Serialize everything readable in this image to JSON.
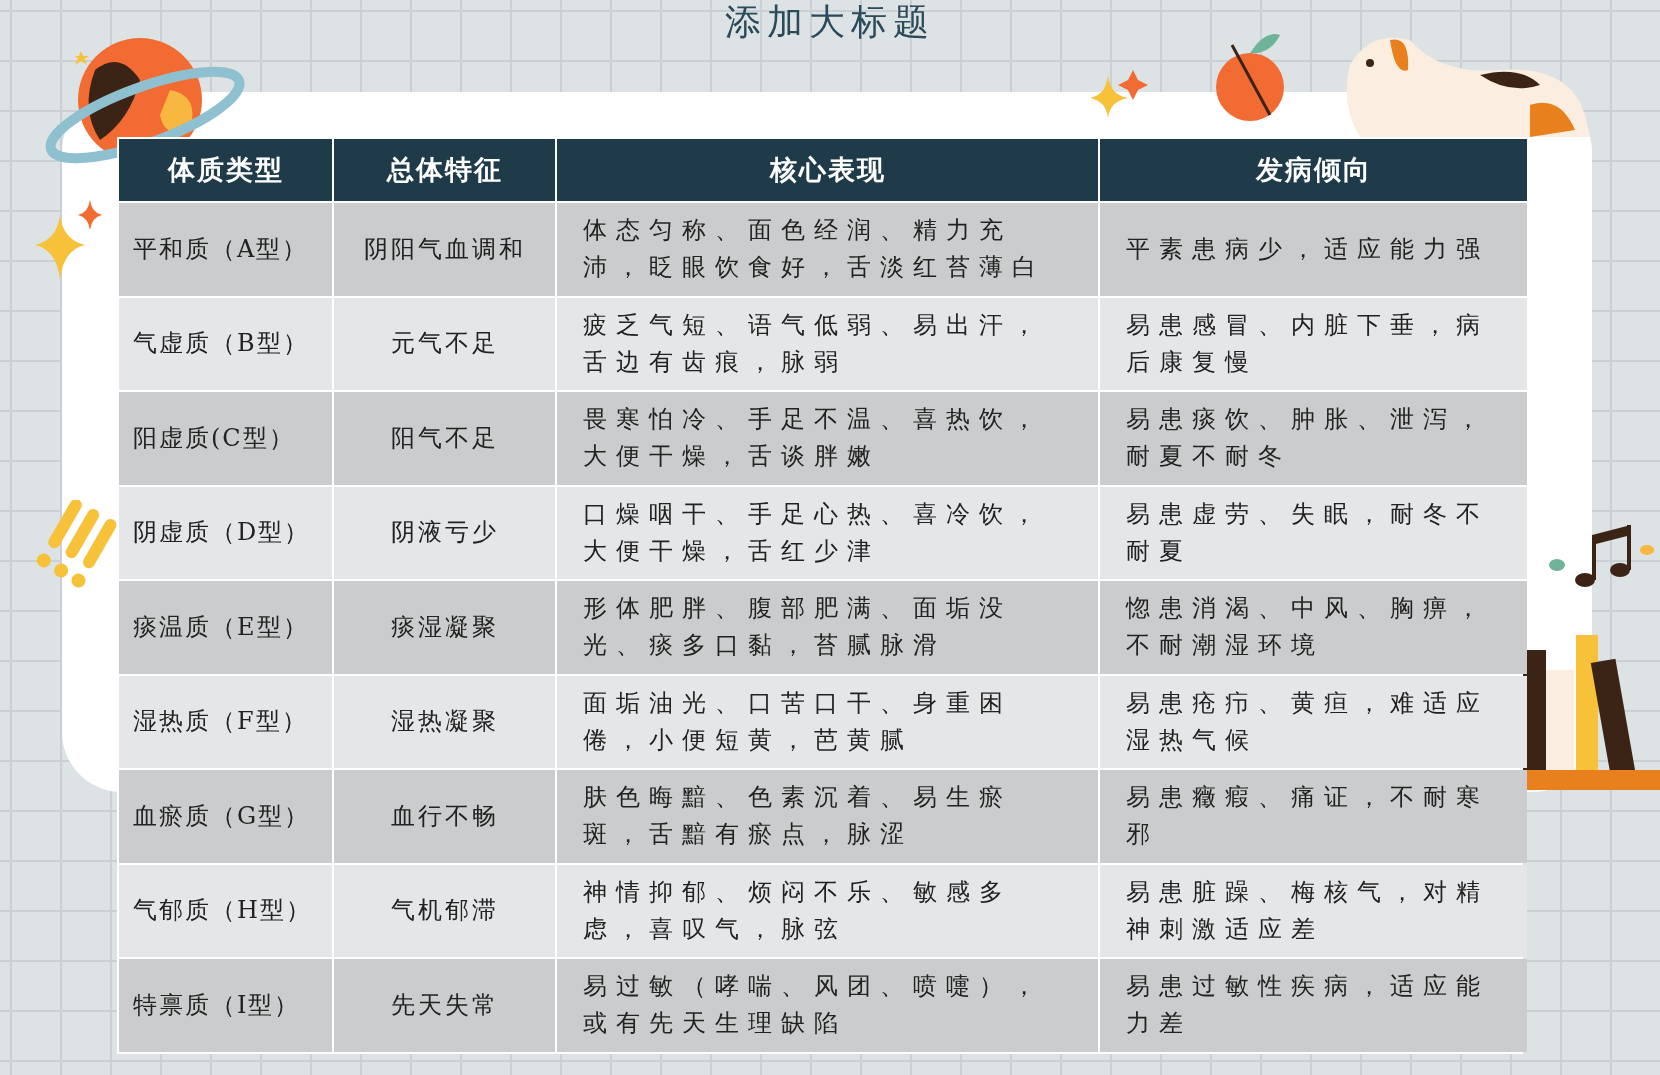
{
  "slide": {
    "title": "添加大标题"
  },
  "table": {
    "columns": [
      "体质类型",
      "总体特征",
      "核心表现",
      "发病倾向"
    ],
    "rows": [
      {
        "cells": [
          "平和质（A型）",
          "阴阳气血调和",
          "体态匀称、面色经润、精力充沛，眨眼饮食好，舌淡红苔薄白",
          "平素患病少，适应能力强"
        ]
      },
      {
        "cells": [
          "气虚质（B型）",
          "元气不足",
          "疲乏气短、语气低弱、易出汗，舌边有齿痕，脉弱",
          "易患感冒、内脏下垂，病后康复慢"
        ]
      },
      {
        "cells": [
          "阳虚质(C型）",
          "阳气不足",
          "畏寒怕冷、手足不温、喜热饮，大便干燥，舌谈胖嫩",
          "易患痰饮、肿胀、泄泻，耐夏不耐冬"
        ]
      },
      {
        "cells": [
          "阴虚质（D型）",
          "阴液亏少",
          "口燥咽干、手足心热、喜冷饮，大便干燥，舌红少津",
          "易患虚劳、失眠，耐冬不耐夏"
        ]
      },
      {
        "cells": [
          "痰温质（E型）",
          "痰湿凝聚",
          "形体肥胖、腹部肥满、面垢没光、痰多口黏，苔腻脉滑",
          "惚患消渴、中风、胸痹，不耐潮湿环境"
        ]
      },
      {
        "cells": [
          "湿热质（F型）",
          "湿热凝聚",
          "面垢油光、口苦口干、身重困倦，小便短黄，芭黄腻",
          "易患疮疖、黄疸，难适应湿热气候"
        ]
      },
      {
        "cells": [
          "血瘀质（G型）",
          "血行不畅",
          "肤色晦黯、色素沉着、易生瘀斑，舌黯有瘀点，脉涩",
          "易患癥瘕、痛证，不耐寒邪"
        ]
      },
      {
        "cells": [
          "气郁质（H型）",
          "气机郁滞",
          "神情抑郁、烦闷不乐、敏感多虑，喜叹气，脉弦",
          "易患脏躁、梅核气，对精神刺激适应差"
        ]
      },
      {
        "cells": [
          "特禀质（I型）",
          "先天失常",
          "易过敏（哮喘、风团、喷嚏），或有先天生理缺陷",
          "易患过敏性疾病，适应能力差"
        ]
      }
    ]
  }
}
